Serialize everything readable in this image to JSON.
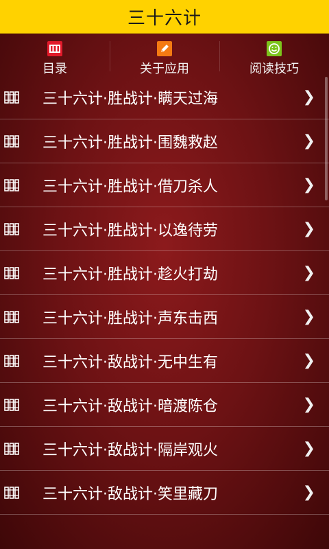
{
  "title": "三十六计",
  "toolbar": [
    {
      "label": "目录",
      "icon": "catalog-icon",
      "color": "#e21a2a"
    },
    {
      "label": "关于应用",
      "icon": "pencil-icon",
      "color": "#f47a12"
    },
    {
      "label": "阅读技巧",
      "icon": "smiley-icon",
      "color": "#7cc41c"
    }
  ],
  "items": [
    "三十六计·胜战计·瞒天过海",
    "三十六计·胜战计·围魏救赵",
    "三十六计·胜战计·借刀杀人",
    "三十六计·胜战计·以逸待劳",
    "三十六计·胜战计·趁火打劫",
    "三十六计·胜战计·声东击西",
    "三十六计·敌战计·无中生有",
    "三十六计·敌战计·暗渡陈仓",
    "三十六计·敌战计·隔岸观火",
    "三十六计·敌战计·笑里藏刀"
  ],
  "colors": {
    "title_bar": "#ffd200",
    "background": "#7a1416"
  }
}
